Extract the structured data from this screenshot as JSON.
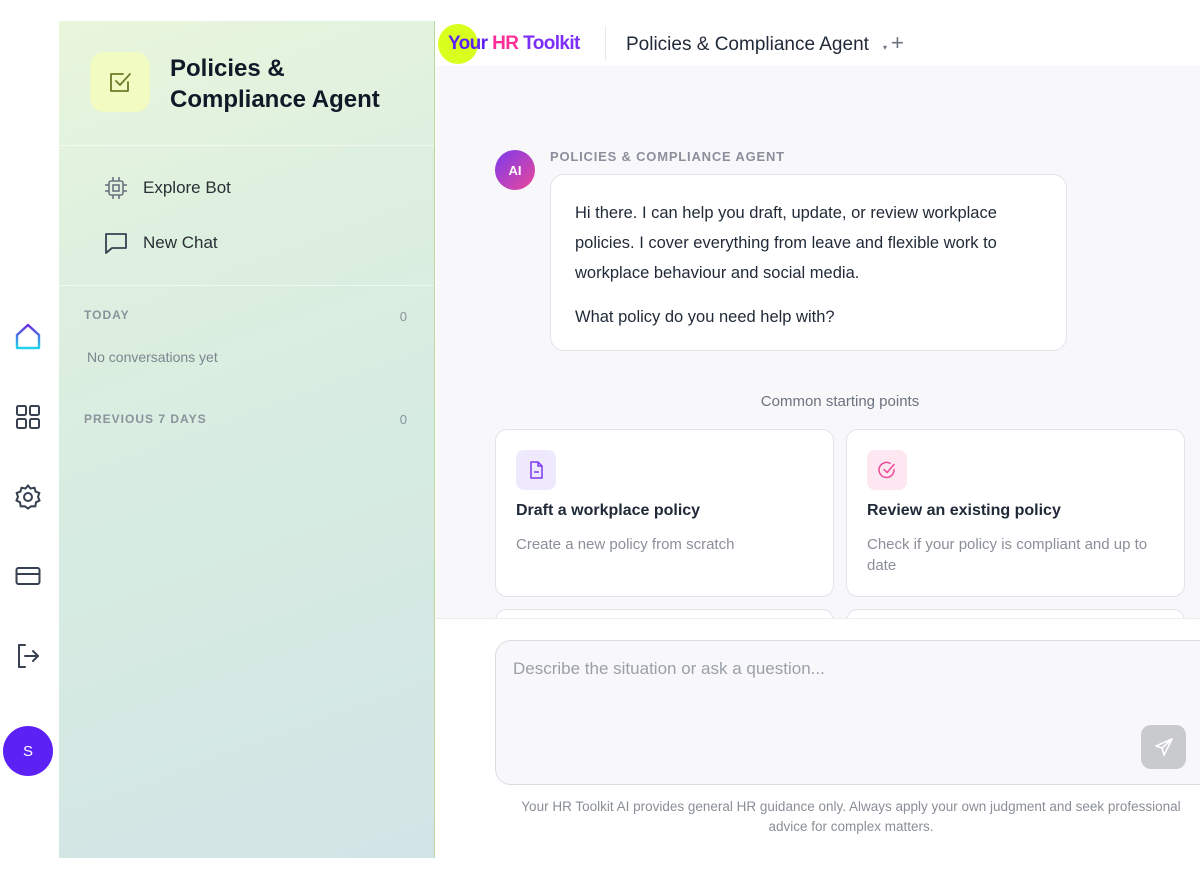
{
  "rail": {
    "avatar_initial": "S"
  },
  "sidebar": {
    "agent_title": "Policies & Compliance Agent",
    "items": [
      {
        "label": "Explore Bot"
      },
      {
        "label": "New Chat"
      }
    ],
    "sections": [
      {
        "heading": "TODAY",
        "count": "0",
        "empty_text": "No conversations yet"
      },
      {
        "heading": "PREVIOUS 7 DAYS",
        "count": "0"
      }
    ]
  },
  "topbar": {
    "logo": {
      "part1": "Your",
      "part2": "HR",
      "part3": "Toolkit"
    },
    "agent_tab": "Policies & Compliance Agent",
    "caret": "▾",
    "add": "+"
  },
  "chat": {
    "badge": "AI",
    "agent_label": "POLICIES & COMPLIANCE AGENT",
    "message_p1": "Hi there. I can help you draft, update, or review workplace policies. I cover everything from leave and flexible work to workplace behaviour and social media.",
    "message_p2": "What policy do you need help with?"
  },
  "starting_points": {
    "heading": "Common starting points",
    "cards": [
      {
        "title": "Draft a workplace policy",
        "desc": "Create a new policy from scratch",
        "icon": "document-icon",
        "color": "#7c3aed",
        "bg": "#efe9fd"
      },
      {
        "title": "Review an existing policy",
        "desc": "Check if your policy is compliant and up to date",
        "icon": "check-circle-icon",
        "color": "#ec4899",
        "bg": "#fde8f2"
      }
    ]
  },
  "composer": {
    "placeholder": "Describe the situation or ask a question...",
    "disclaimer": "Your HR Toolkit AI provides general HR guidance only. Always apply your own judgment and seek professional advice for complex matters."
  }
}
